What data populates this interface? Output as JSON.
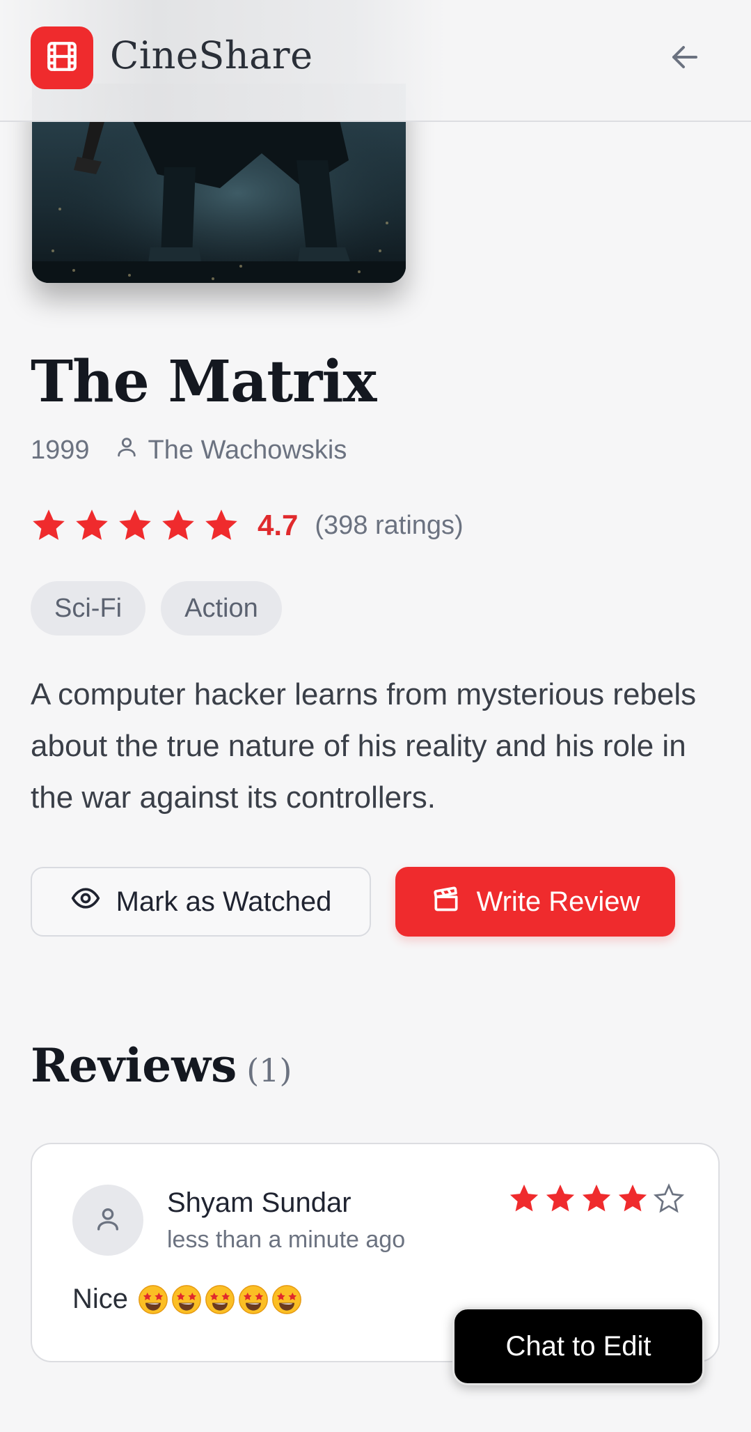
{
  "header": {
    "brand": "CineShare",
    "logo_icon": "film-icon",
    "back_icon": "arrow-left-icon"
  },
  "movie": {
    "title": "The Matrix",
    "year": "1999",
    "director": "The Wachowskis",
    "rating": "4.7",
    "rating_stars_filled": 5,
    "ratings_count": "(398 ratings)",
    "genres": [
      "Sci-Fi",
      "Action"
    ],
    "description": "A computer hacker learns from mysterious rebels about the true nature of his reality and his role in the war against its controllers."
  },
  "actions": {
    "watched_label": "Mark as Watched",
    "review_label": "Write Review"
  },
  "reviews": {
    "heading": "Reviews",
    "count": "(1)",
    "items": [
      {
        "author": "Shyam Sundar",
        "time": "less than a minute ago",
        "stars": 4,
        "max_stars": 5,
        "text": "Nice",
        "emoji": "star-struck-emoji",
        "emoji_count": 5
      }
    ]
  },
  "chat": {
    "label": "Chat to Edit"
  },
  "colors": {
    "accent": "#ef2b2d",
    "background": "#f6f6f7",
    "muted_text": "#6b7280"
  }
}
